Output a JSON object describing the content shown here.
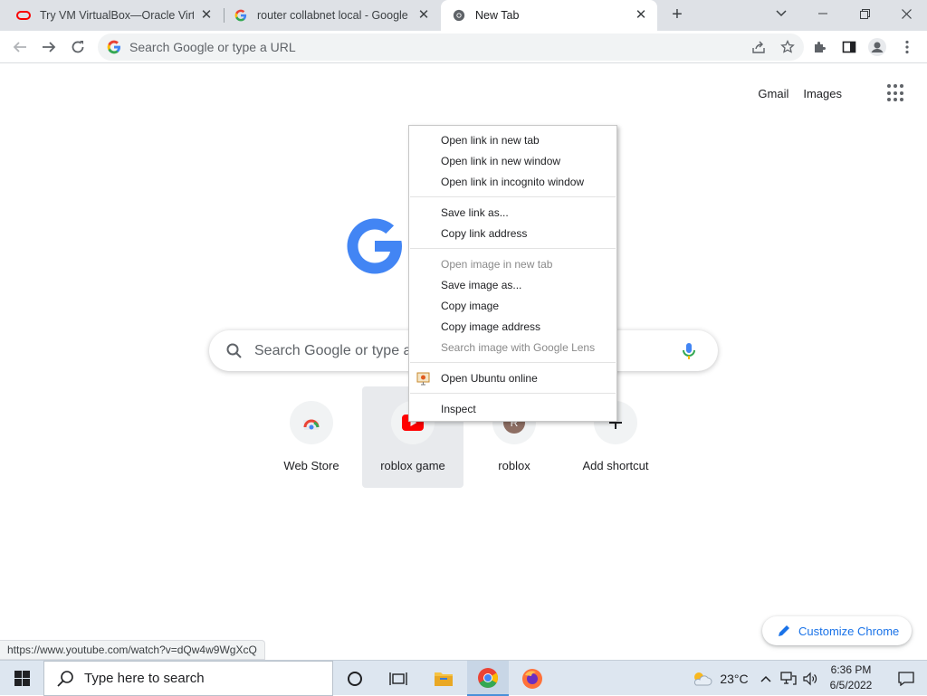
{
  "browser": {
    "tabs": [
      {
        "title": "Try VM VirtualBox—Oracle Virtua",
        "favicon": "oracle-icon",
        "active": false
      },
      {
        "title": "router collabnet local - Google Se",
        "favicon": "google-icon",
        "active": false
      },
      {
        "title": "New Tab",
        "favicon": "chrome-icon",
        "active": true
      }
    ],
    "omnibox_placeholder": "Search Google or type a URL"
  },
  "page": {
    "top_links": {
      "gmail": "Gmail",
      "images": "Images"
    },
    "search_placeholder": "Search Google or type a",
    "shortcuts": [
      {
        "label": "Web Store",
        "icon": "chrome-web-store-icon"
      },
      {
        "label": "roblox game",
        "icon": "youtube-icon"
      },
      {
        "label": "roblox",
        "icon": "letter-r-avatar",
        "letter": "R"
      },
      {
        "label": "Add shortcut",
        "icon": "plus-icon"
      }
    ],
    "customize_label": "Customize Chrome",
    "status_url": "https://www.youtube.com/watch?v=dQw4w9WgXcQ"
  },
  "context_menu": {
    "groups": [
      [
        {
          "label": "Open link in new tab",
          "enabled": true
        },
        {
          "label": "Open link in new window",
          "enabled": true
        },
        {
          "label": "Open link in incognito window",
          "enabled": true
        }
      ],
      [
        {
          "label": "Save link as...",
          "enabled": true
        },
        {
          "label": "Copy link address",
          "enabled": true
        }
      ],
      [
        {
          "label": "Open image in new tab",
          "enabled": false
        },
        {
          "label": "Save image as...",
          "enabled": true
        },
        {
          "label": "Copy image",
          "enabled": true
        },
        {
          "label": "Copy image address",
          "enabled": true
        },
        {
          "label": "Search image with Google Lens",
          "enabled": false
        }
      ],
      [
        {
          "label": "Open Ubuntu online",
          "enabled": true,
          "icon": "extension-icon"
        }
      ],
      [
        {
          "label": "Inspect",
          "enabled": true
        }
      ]
    ]
  },
  "taskbar": {
    "search_placeholder": "Type here to search",
    "weather": "23°C",
    "time": "6:36 PM",
    "date": "6/5/2022"
  },
  "colors": {
    "google_blue": "#4285f4",
    "google_red": "#ea4335",
    "google_yellow": "#fbbc05",
    "google_green": "#34a853",
    "accent": "#1a73e8",
    "tabstrip_bg": "#dee1e6",
    "taskbar_bg": "#dde6f0"
  }
}
